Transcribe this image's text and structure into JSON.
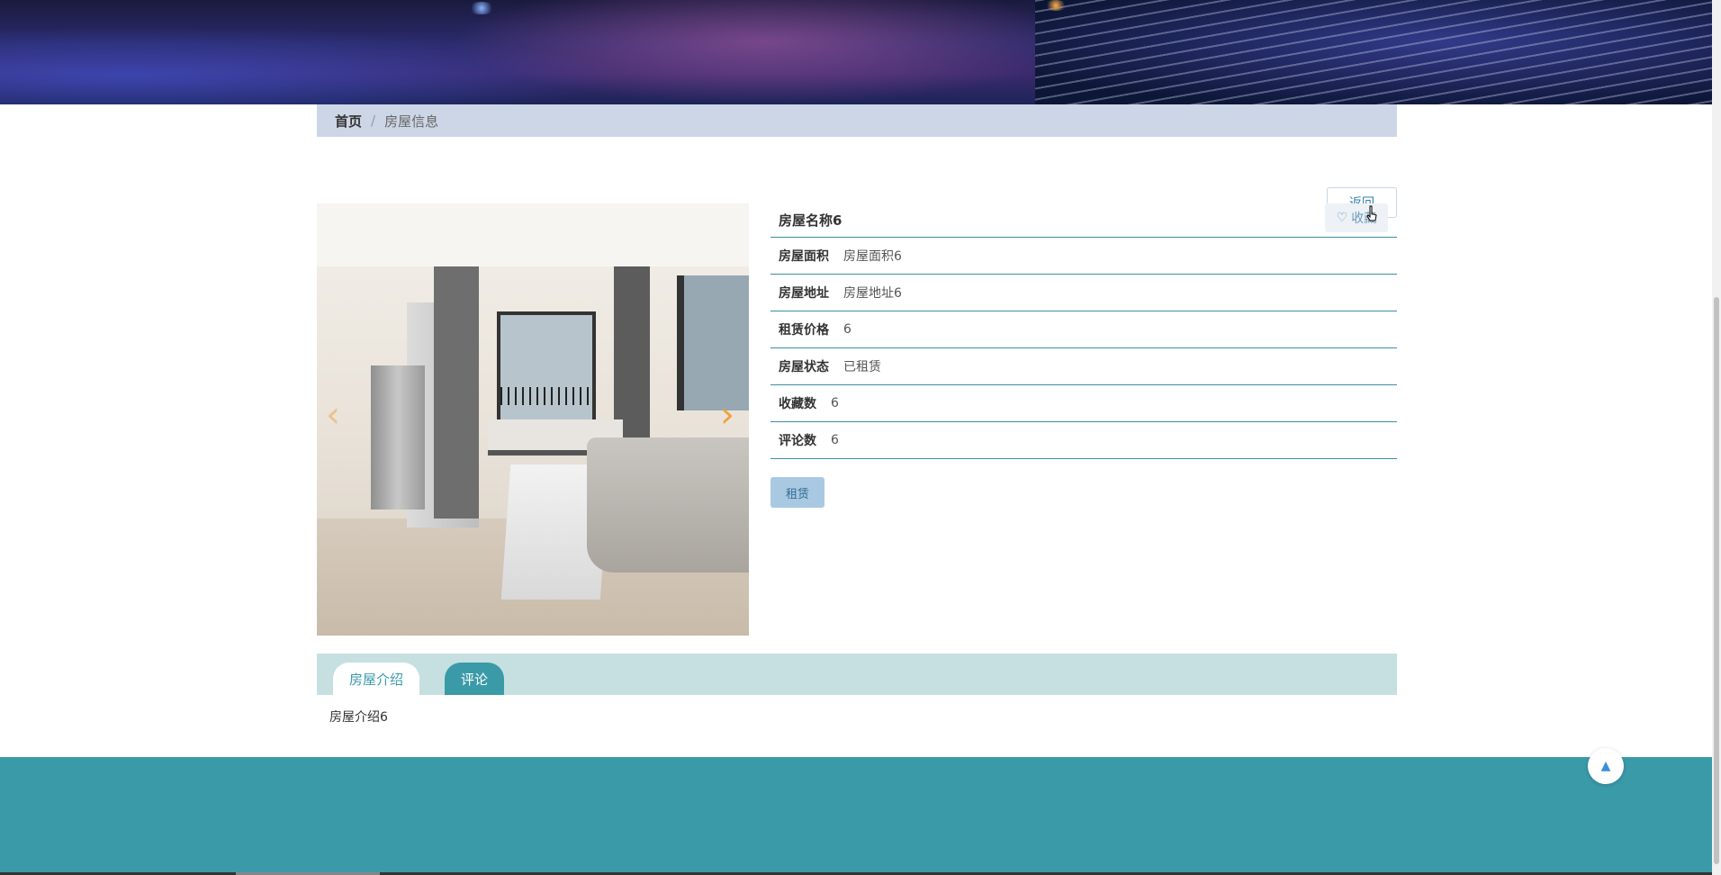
{
  "breadcrumb": {
    "home": "首页",
    "separator": "/",
    "current": "房屋信息"
  },
  "actions": {
    "back_label": "返回",
    "favorite_label": "收藏",
    "rent_label": "租赁"
  },
  "house": {
    "name": "房屋名称6",
    "fields": [
      {
        "label": "房屋面积",
        "value": "房屋面积6"
      },
      {
        "label": "房屋地址",
        "value": "房屋地址6"
      },
      {
        "label": "租赁价格",
        "value": "6"
      },
      {
        "label": "房屋状态",
        "value": "已租赁"
      },
      {
        "label": "收藏数",
        "value": "6"
      },
      {
        "label": "评论数",
        "value": "6"
      }
    ]
  },
  "carousel": {
    "prev_icon": "‹",
    "next_icon": "›"
  },
  "tabs": [
    {
      "label": "房屋介绍",
      "active": false
    },
    {
      "label": "评论",
      "active": true
    }
  ],
  "intro_text": "房屋介绍6",
  "to_top_icon": "▲",
  "colors": {
    "accent": "#3a9aa8",
    "breadcrumb_bg": "#cdd6e6",
    "tabs_bg": "#c6e0e2",
    "rent_btn": "#a9c8e2"
  }
}
